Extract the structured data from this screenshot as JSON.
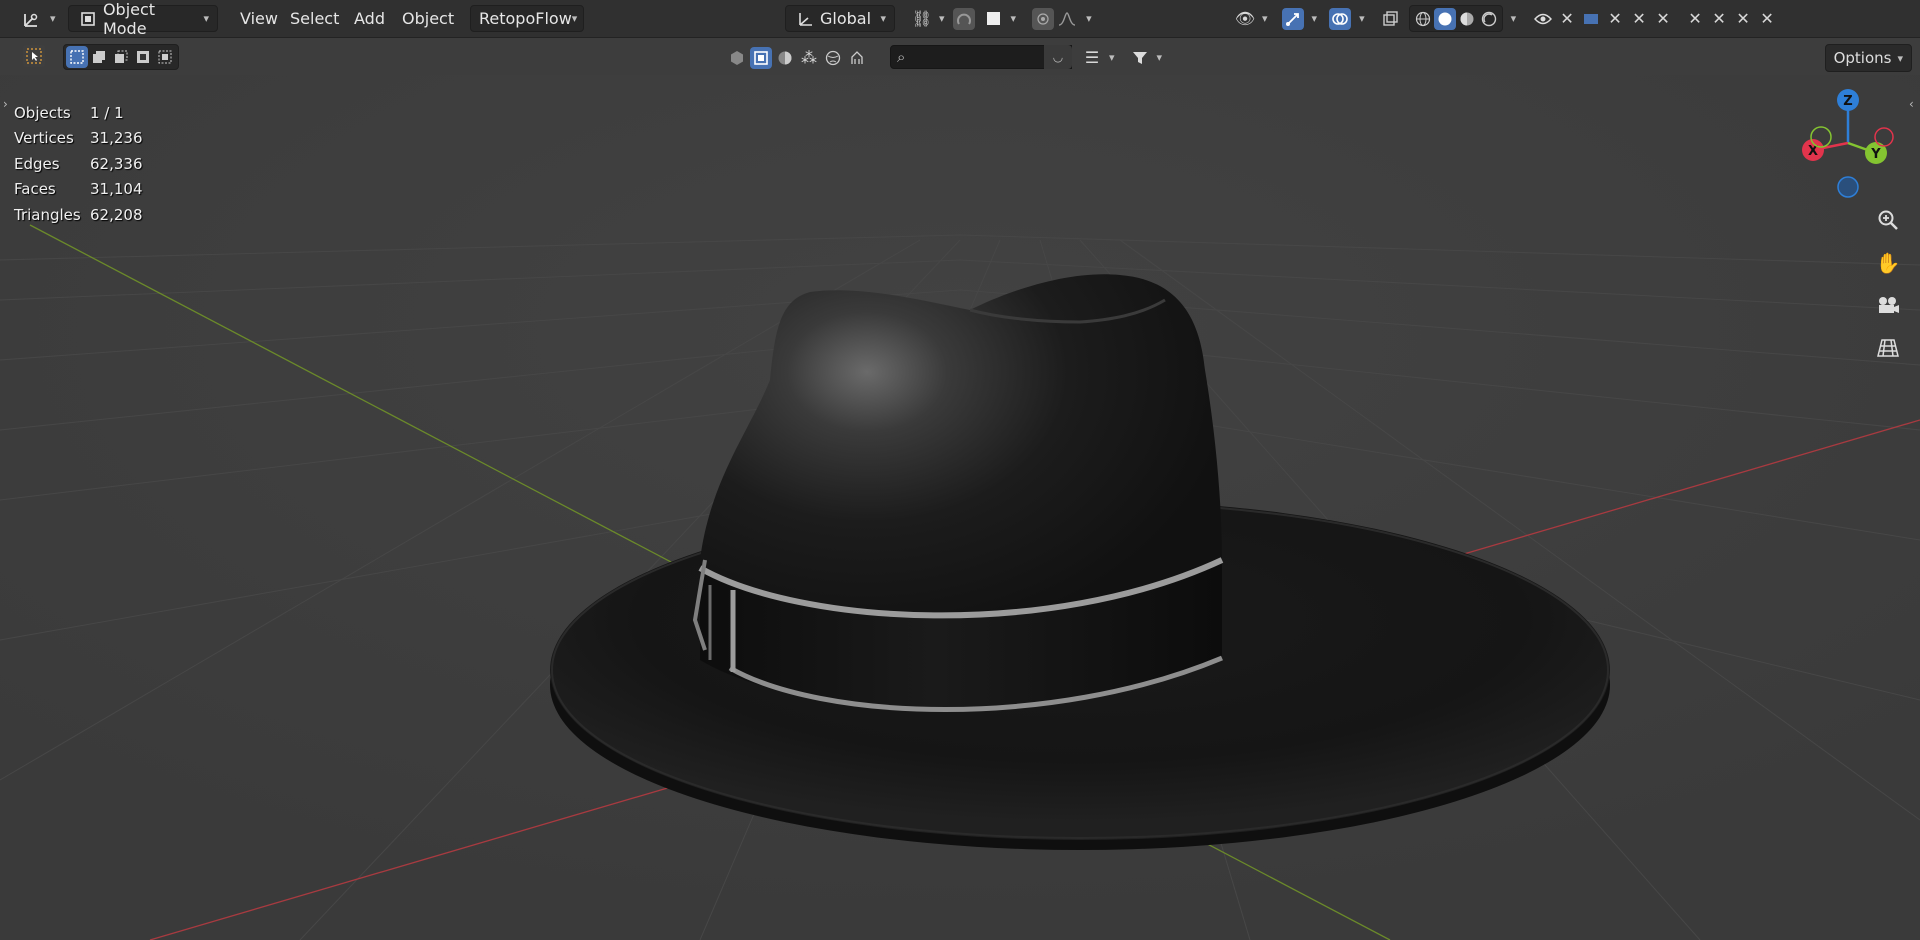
{
  "header": {
    "mode_label": "Object Mode",
    "menus": [
      "View",
      "Select",
      "Add",
      "Object"
    ],
    "addon_menu": "RetopoFlow",
    "orientation_label": "Global"
  },
  "toolbar": {
    "search_placeholder": "",
    "options_label": "Options"
  },
  "stats": [
    {
      "label": "Objects",
      "value": "1 / 1"
    },
    {
      "label": "Vertices",
      "value": "31,236"
    },
    {
      "label": "Edges",
      "value": "62,336"
    },
    {
      "label": "Faces",
      "value": "31,104"
    },
    {
      "label": "Triangles",
      "value": "62,208"
    }
  ],
  "gizmo": {
    "z_label": "Z",
    "x_label": "X",
    "y_label": "Y",
    "colors": {
      "x": "#e2344c",
      "y": "#84c431",
      "z": "#2e7fd8"
    }
  },
  "theme": {
    "accent": "#4772b3",
    "viewport_bg": "#3d3d3d",
    "header_bg": "#303030"
  }
}
